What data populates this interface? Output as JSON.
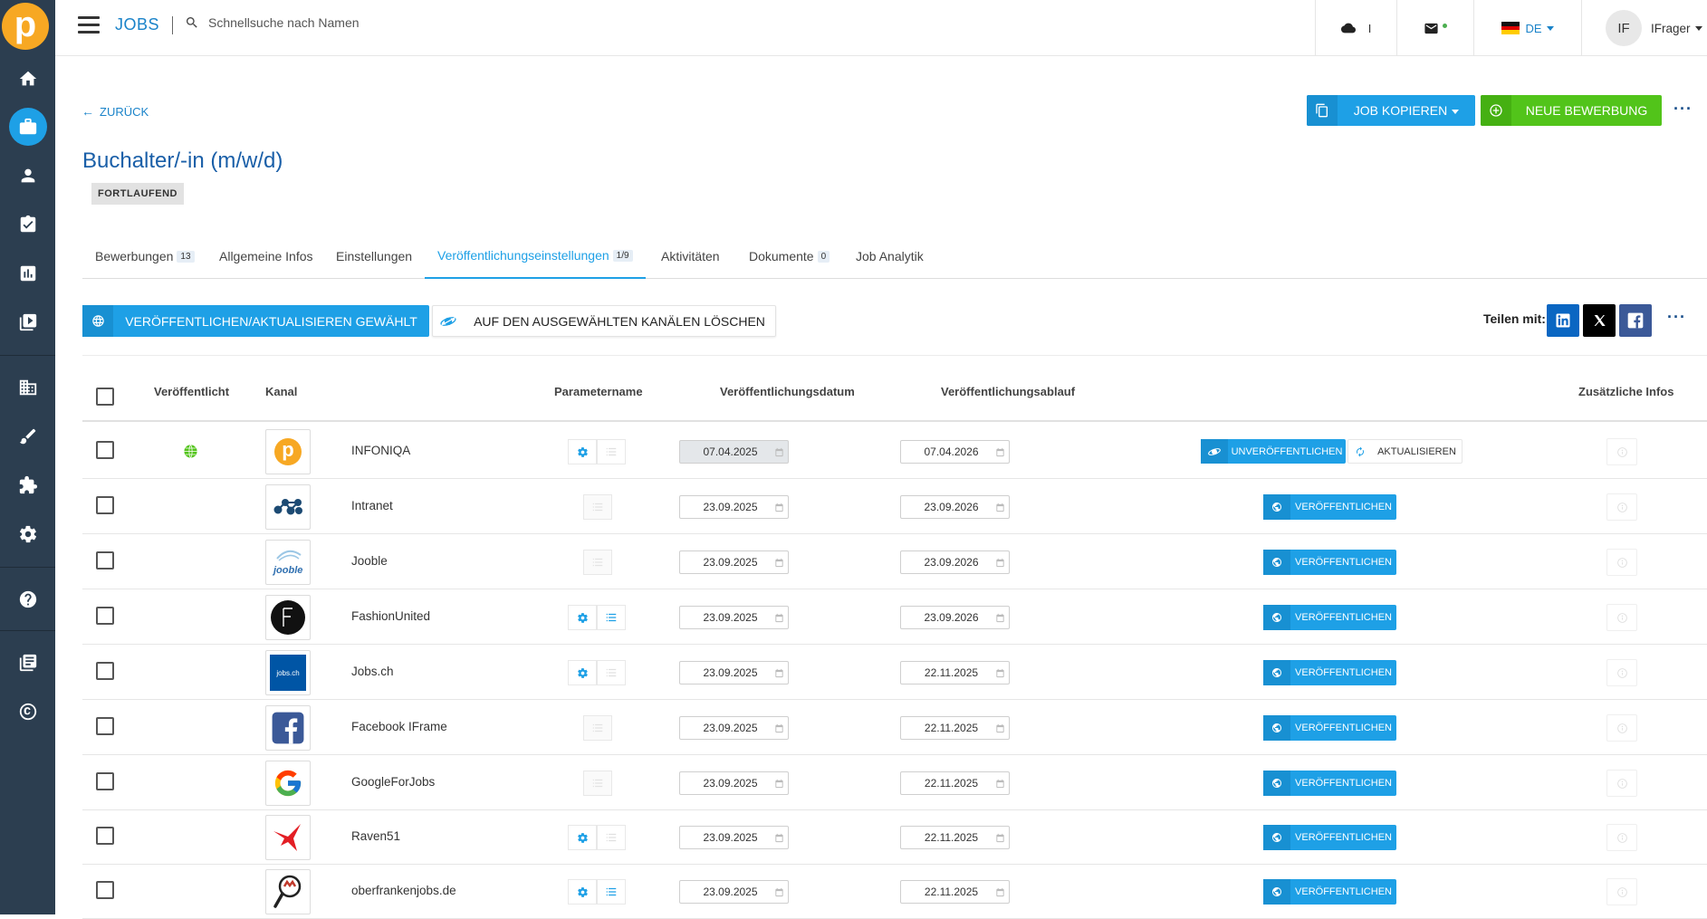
{
  "app": {
    "section_title": "JOBS",
    "search_placeholder": "Schnellsuche nach Namen",
    "logo_letter": "p"
  },
  "topbar": {
    "cloud_count": "I",
    "language": "DE",
    "user_initials": "IF",
    "user_name": "IFrager"
  },
  "colors": {
    "accent": "#1ea0e6",
    "success": "#52c41a",
    "sidebar": "#2c3e50",
    "title": "#1a5fa8"
  },
  "header": {
    "back_label": "ZURÜCK",
    "copy_button": "JOB KOPIEREN",
    "new_application_button": "NEUE BEWERBUNG",
    "job_title": "Buchalter/-in (m/w/d)",
    "status": "FORTLAUFEND"
  },
  "tabs": [
    {
      "label": "Bewerbungen",
      "count": "13"
    },
    {
      "label": "Allgemeine Infos",
      "count": ""
    },
    {
      "label": "Einstellungen",
      "count": ""
    },
    {
      "label": "Veröffentlichungseinstellungen",
      "count": "1/9"
    },
    {
      "label": "Aktivitäten",
      "count": ""
    },
    {
      "label": "Dokumente",
      "count": "0"
    },
    {
      "label": "Job Analytik",
      "count": ""
    }
  ],
  "actions": {
    "publish_selected": "VERÖFFENTLICHEN/AKTUALISIEREN GEWÄHLT",
    "delete_selected": "AUF DEN AUSGEWÄHLTEN KANÄLEN LÖSCHEN",
    "share_label": "Teilen mit:",
    "share_targets": [
      "linkedin-icon",
      "x-icon",
      "facebook-icon"
    ]
  },
  "table": {
    "headers": {
      "published": "Veröffentlicht",
      "channel": "Kanal",
      "param": "Parametername",
      "pub_date": "Veröffentlichungsdatum",
      "expiry": "Veröffentlichungsablauf",
      "extra": "Zusätzliche Infos"
    },
    "unpublish_label": "UNVERÖFFENTLICHEN",
    "update_label": "AKTUALISIEREN",
    "publish_label": "VERÖFFENTLICHEN",
    "rows": [
      {
        "name": "INFONIQA",
        "logo": "infoniqa-logo",
        "published": true,
        "params": "gear-list",
        "pub_date": "07.04.2025",
        "expiry": "07.04.2026"
      },
      {
        "name": "Intranet",
        "logo": "intranet-logo",
        "published": false,
        "params": "none",
        "pub_date": "23.09.2025",
        "expiry": "23.09.2026"
      },
      {
        "name": "Jooble",
        "logo": "jooble-logo",
        "published": false,
        "params": "none",
        "pub_date": "23.09.2025",
        "expiry": "23.09.2026"
      },
      {
        "name": "FashionUnited",
        "logo": "fashionunited-logo",
        "published": false,
        "params": "gear-list-active",
        "pub_date": "23.09.2025",
        "expiry": "23.09.2026"
      },
      {
        "name": "Jobs.ch",
        "logo": "jobsch-logo",
        "published": false,
        "params": "gear-list",
        "pub_date": "23.09.2025",
        "expiry": "22.11.2025"
      },
      {
        "name": "Facebook IFrame",
        "logo": "facebook-logo",
        "published": false,
        "params": "none",
        "pub_date": "23.09.2025",
        "expiry": "22.11.2025"
      },
      {
        "name": "GoogleForJobs",
        "logo": "google-logo",
        "published": false,
        "params": "none",
        "pub_date": "23.09.2025",
        "expiry": "22.11.2025"
      },
      {
        "name": "Raven51",
        "logo": "raven51-logo",
        "published": false,
        "params": "gear-list",
        "pub_date": "23.09.2025",
        "expiry": "22.11.2025"
      },
      {
        "name": "oberfrankenjobs.de",
        "logo": "oberfrankenjobs-logo",
        "published": false,
        "params": "gear-list-active",
        "pub_date": "23.09.2025",
        "expiry": "22.11.2025"
      }
    ]
  },
  "logo_texts": {
    "jobsch": "jobs.ch",
    "jooble": "jooble"
  }
}
